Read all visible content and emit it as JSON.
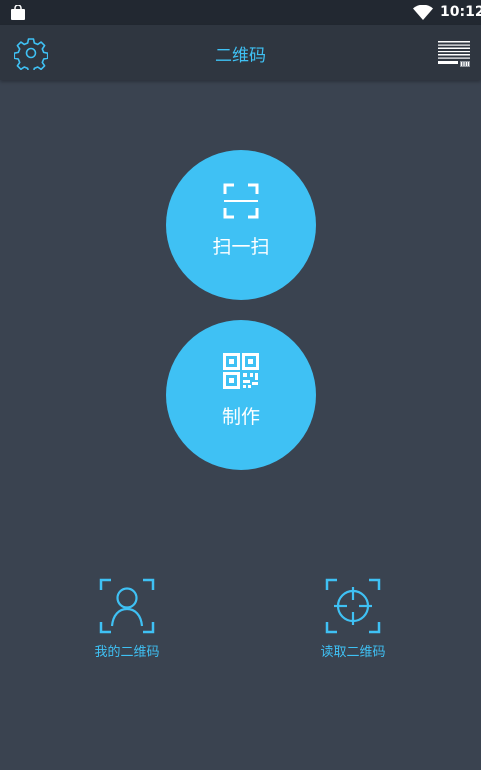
{
  "status_bar": {
    "time": "10:12",
    "icons": [
      "shopping-bag-icon",
      "wifi-icon"
    ]
  },
  "app_bar": {
    "title": "二维码",
    "left_icon": "gear-icon",
    "right_icon": "barcode-menu-icon"
  },
  "actions": {
    "scan": {
      "label": "扫一扫",
      "icon": "scan-frame-icon"
    },
    "make": {
      "label": "制作",
      "icon": "qr-code-icon"
    }
  },
  "bottom": {
    "my_qr": {
      "label": "我的二维码",
      "icon": "user-frame-icon"
    },
    "read_qr": {
      "label": "读取二维码",
      "icon": "crosshair-frame-icon"
    }
  },
  "colors": {
    "accent": "#3fc1f4",
    "background": "#3a4350",
    "app_bar": "#2f3640",
    "status_bar": "#222831"
  }
}
